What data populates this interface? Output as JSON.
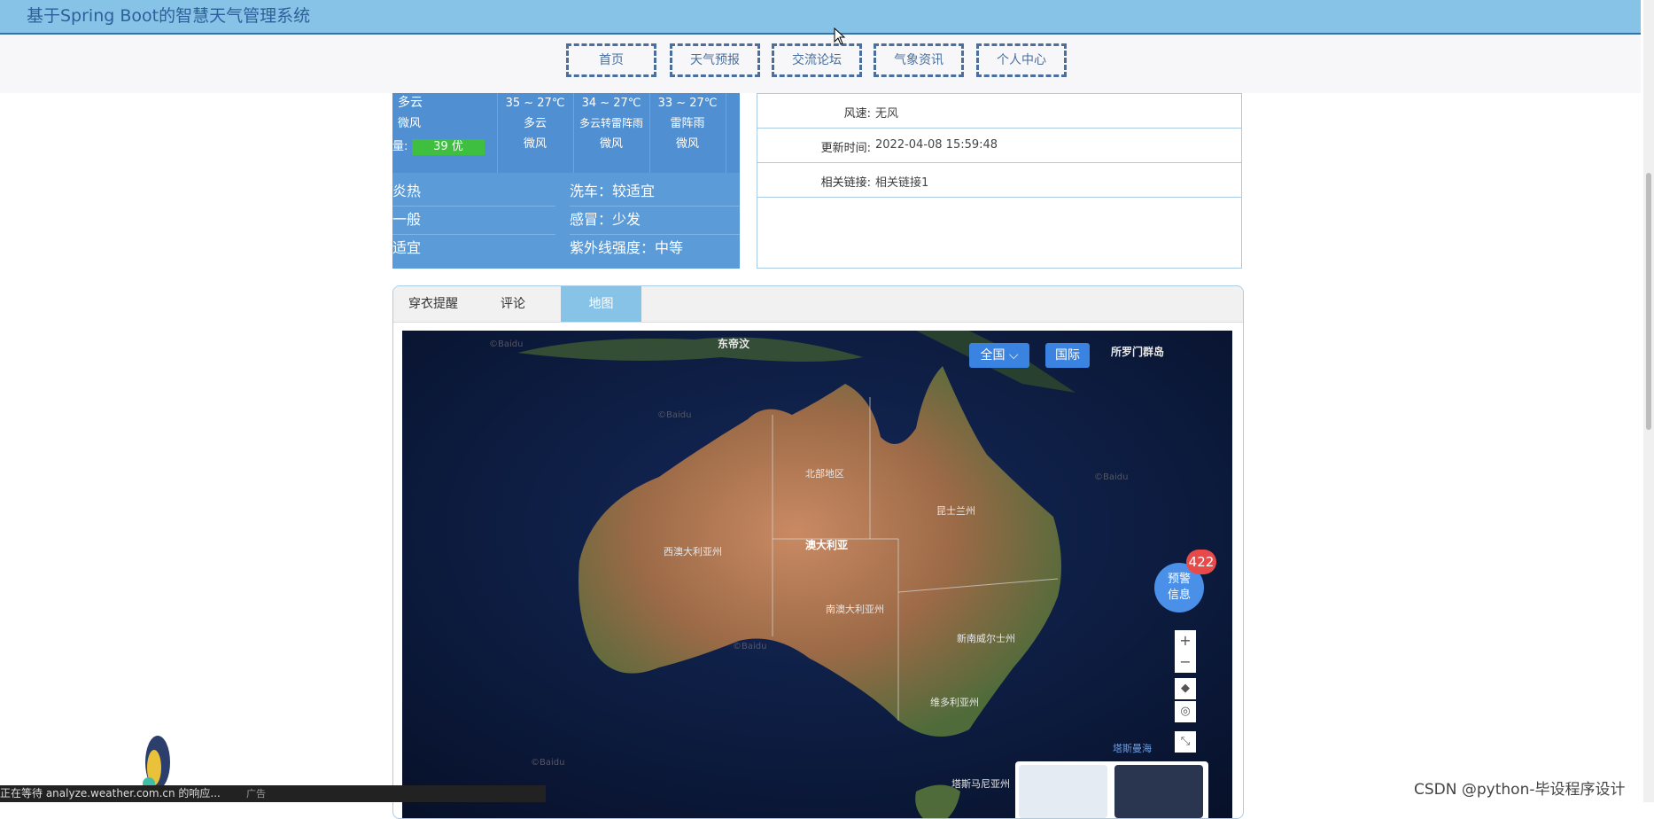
{
  "header": {
    "title": "基于Spring Boot的智慧天气管理系统"
  },
  "nav": {
    "items": [
      "首页",
      "天气预报",
      "交流论坛",
      "气象资讯",
      "个人中心"
    ]
  },
  "weather": {
    "today": {
      "condition": "多云",
      "wind": "微风",
      "aqi_label": "量:",
      "aqi": "39 优"
    },
    "days": [
      {
        "temp": "35 ~ 27℃",
        "condition": "多云",
        "wind": "微风"
      },
      {
        "temp": "34 ~ 27℃",
        "condition": "多云转雷阵雨",
        "wind": "微风"
      },
      {
        "temp": "33 ~ 27℃",
        "condition": "雷阵雨",
        "wind": "微风"
      }
    ],
    "indices_left": [
      "炎热",
      "一般",
      "适宜"
    ],
    "indices_right": [
      "洗车：较适宜",
      "感冒：少发",
      "紫外线强度：中等"
    ]
  },
  "info": {
    "rows": [
      {
        "label": "风速:",
        "value": "无风"
      },
      {
        "label": "更新时间:",
        "value": "2022-04-08 15:59:48"
      },
      {
        "label": "相关链接:",
        "value": "相关链接1"
      }
    ]
  },
  "tabs": {
    "items": [
      "穿衣提醒",
      "评论",
      "地图"
    ],
    "active": "地图"
  },
  "map": {
    "btn_china": "全国",
    "btn_intl": "国际",
    "labels": {
      "east_timor": "东帝汶",
      "solomon": "所罗门群岛",
      "australia": "澳大利亚",
      "northern_territory": "北部地区",
      "queensland": "昆士兰州",
      "western_australia": "西澳大利亚州",
      "south_australia": "南澳大利亚州",
      "nsw": "新南威尔士州",
      "victoria": "维多利亚州",
      "tasman": "塔斯曼海",
      "tasmania": "塔斯马尼亚州",
      "baidu": "©Baidu"
    },
    "alert": {
      "line1": "预警",
      "line2": "信息",
      "count": "422"
    },
    "zoom_in": "+",
    "zoom_out": "−"
  },
  "status": {
    "text": "正在等待 analyze.weather.com.cn 的响应...",
    "ad": "广告"
  },
  "watermark": "CSDN @python-毕设程序设计",
  "colors": {
    "topbar": "#87c3e6",
    "accent": "#4a6f9e",
    "active_tab": "#87c3e6",
    "aqi_good": "#3fbf3f",
    "alert_badge": "#e84a4a"
  }
}
